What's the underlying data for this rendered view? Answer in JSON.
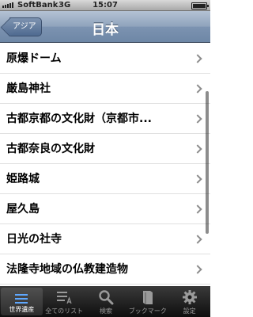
{
  "status_bar": {
    "carrier": "SoftBank",
    "network": "3G",
    "time": "15:07"
  },
  "nav": {
    "back_label": "アジア",
    "title": "日本"
  },
  "list": {
    "items": [
      {
        "label": "原爆ドーム"
      },
      {
        "label": "厳島神社"
      },
      {
        "label": "古都京都の文化財（京都市..."
      },
      {
        "label": "古都奈良の文化財"
      },
      {
        "label": "姫路城"
      },
      {
        "label": "屋久島"
      },
      {
        "label": "日光の社寺"
      },
      {
        "label": "法隆寺地域の仏教建造物"
      }
    ]
  },
  "tab_bar": {
    "tabs": [
      {
        "label": "世界遺産",
        "icon": "list-icon"
      },
      {
        "label": "全てのリスト",
        "icon": "alphabet-list-icon"
      },
      {
        "label": "検索",
        "icon": "search-icon"
      },
      {
        "label": "ブックマーク",
        "icon": "bookmark-icon"
      },
      {
        "label": "設定",
        "icon": "gear-icon"
      }
    ]
  }
}
